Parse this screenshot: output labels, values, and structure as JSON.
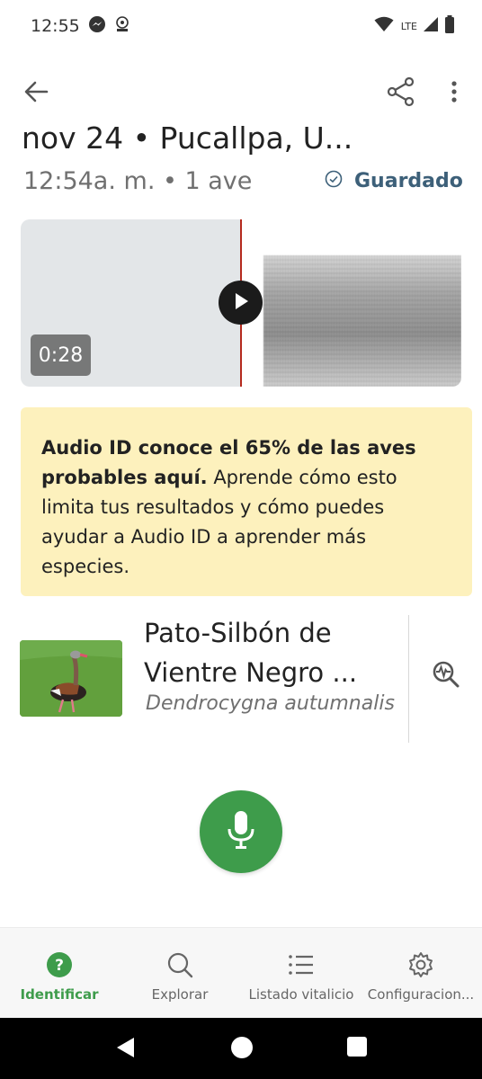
{
  "status_bar": {
    "time": "12:55",
    "network_label": "LTE"
  },
  "header": {
    "title": "nov 24 • Pucallpa, U...",
    "subtitle": "12:54a. m. • 1 ave",
    "saved_label": "Guardado"
  },
  "player": {
    "duration": "0:28",
    "playhead_color": "#b52a1e"
  },
  "info_card": {
    "bold_text": "Audio ID conoce el 65% de las aves probables aquí.",
    "body_text": " Aprende cómo esto limita tus resultados y cómo puedes ayudar a Audio ID a aprender más especies.",
    "background": "#fdf1bd"
  },
  "species": {
    "common_name": "Pato-Silbón de Vientre Negro  ...",
    "scientific_name": "Dendrocygna autumnalis"
  },
  "bottom_nav": {
    "items": [
      {
        "label": "Identificar",
        "icon": "question-circle-icon",
        "active": true
      },
      {
        "label": "Explorar",
        "icon": "search-icon",
        "active": false
      },
      {
        "label": "Listado vitalicio",
        "icon": "list-icon",
        "active": false
      },
      {
        "label": "Configuracion...",
        "icon": "gear-icon",
        "active": false
      }
    ]
  },
  "colors": {
    "accent_green": "#3e9c4b",
    "saved_blue": "#3d6079"
  }
}
